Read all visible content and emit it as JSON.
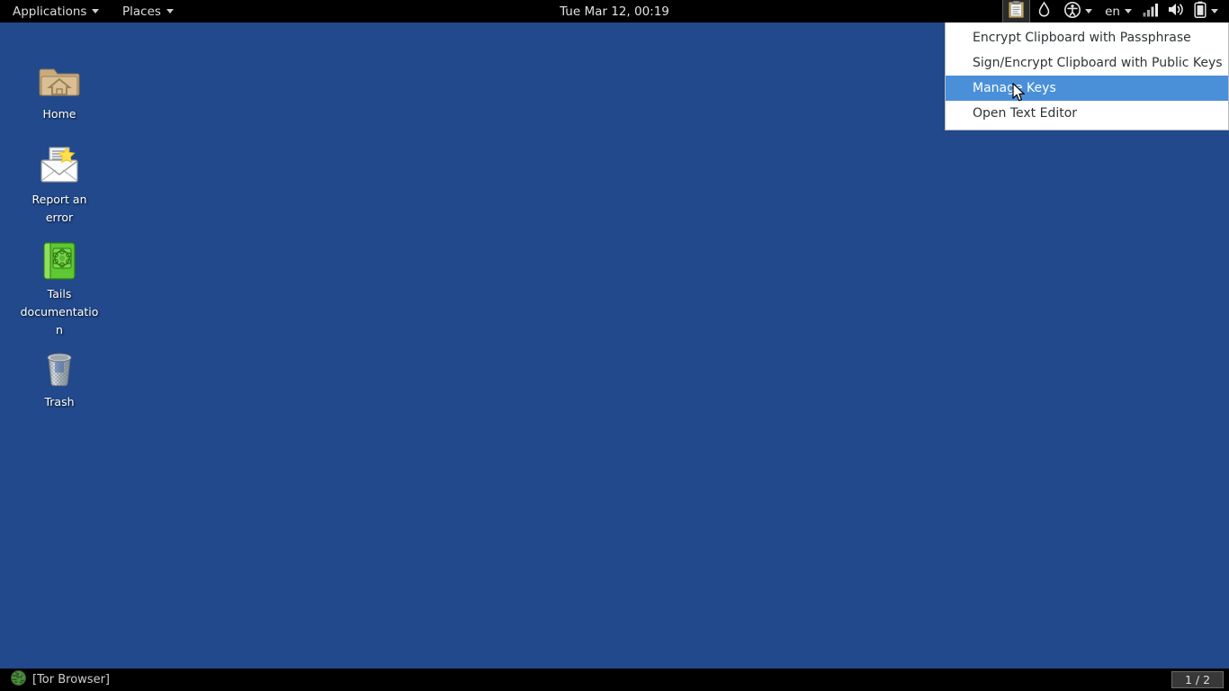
{
  "desktop": {
    "background_color": "#21498c",
    "icons": [
      {
        "name": "home",
        "label": "Home",
        "icon": "folder-home-icon"
      },
      {
        "name": "report-an-error",
        "label": "Report an error",
        "icon": "mail-report-icon"
      },
      {
        "name": "tails-documentation",
        "label": "Tails documentation",
        "icon": "green-book-icon"
      },
      {
        "name": "trash",
        "label": "Trash",
        "icon": "trash-can-icon"
      }
    ]
  },
  "top_panel": {
    "background_color": "#000000",
    "applications_label": "Applications",
    "places_label": "Places",
    "clock": "Tue Mar 12, 00:19",
    "tray": [
      {
        "name": "clipboard",
        "icon": "clipboard-icon",
        "active": true
      },
      {
        "name": "onion-drop",
        "icon": "onion-drop-icon",
        "active": false
      },
      {
        "name": "accessibility",
        "icon": "accessibility-icon",
        "has_caret": true
      },
      {
        "name": "keyboard-layout",
        "icon": "keyboard-layout-icon",
        "label": "en",
        "has_caret": true
      },
      {
        "name": "network",
        "icon": "network-signal-icon"
      },
      {
        "name": "volume",
        "icon": "volume-speaker-icon"
      },
      {
        "name": "battery",
        "icon": "battery-icon",
        "has_caret": true
      }
    ]
  },
  "clipboard_menu": {
    "highlight_color": "#4a90d9",
    "items": [
      {
        "label": "Encrypt Clipboard with Passphrase",
        "highlighted": false
      },
      {
        "label": "Sign/Encrypt Clipboard with Public Keys",
        "highlighted": false
      },
      {
        "label": "Manage Keys",
        "highlighted": true
      },
      {
        "label": "Open Text Editor",
        "highlighted": false
      }
    ]
  },
  "bottom_panel": {
    "background_color": "#000000",
    "task_label": "[Tor Browser]",
    "task_icon": "tor-globe-icon",
    "workspace": "1 / 2"
  }
}
